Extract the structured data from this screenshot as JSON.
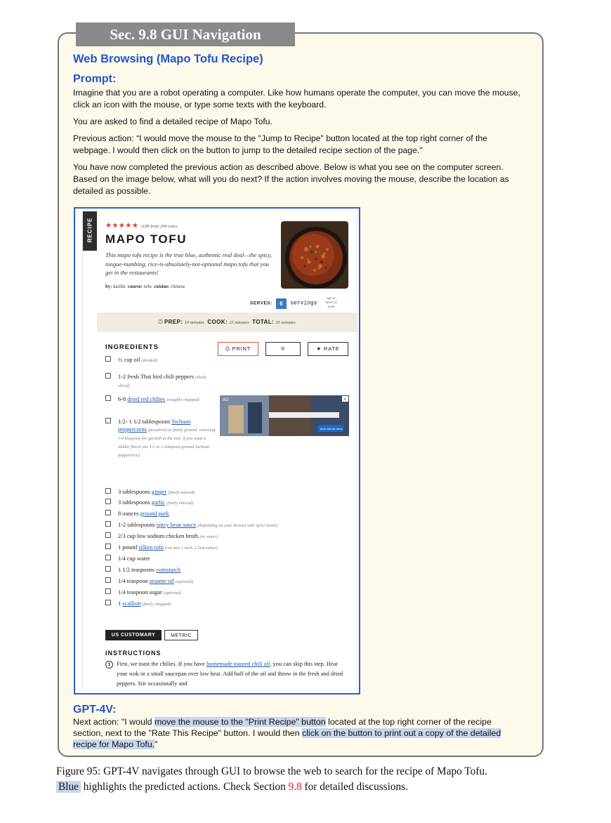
{
  "section_tab": "Sec. 9.8 GUI Navigation",
  "heading": "Web Browsing (Mapo Tofu Recipe)",
  "prompt_label": "Prompt:",
  "prompt": {
    "p1": "Imagine that you are a robot operating a computer. Like how humans operate the computer, you can move the mouse, click an icon with the mouse, or type some texts with the keyboard.",
    "p2": "You are asked to find a detailed recipe of Mapo Tofu.",
    "p3": "Previous action: “I would move the mouse to the \"Jump to Recipe\" button located at the top right corner of the webpage. I would then click on the button to jump to the detailed recipe section of the page.\"",
    "p4": "You have now completed the previous action as described above. Below is what you see on the computer screen. Based on the image below, what will you do next? If the action involves moving the mouse, describe the location as detailed as possible."
  },
  "screenshot": {
    "recipe_tag": "RECIPE",
    "stars": "★★★★★",
    "rating_text": "4.89 from 299 votes",
    "title": "MAPO TOFU",
    "description": "This mapo tofu recipe is the true blue, authentic real deal—the spicy, tongue-numbing, rice-is-absolutely-not-optional mapo tofu that you get in the restaurants!",
    "byline": {
      "by_label": "by:",
      "by": "kaitlin",
      "course_label": "course:",
      "course": "tofu",
      "cuisine_label": "cuisine:",
      "cuisine": "chinese"
    },
    "serves_label": "SERVES:",
    "serves_value": "6",
    "servings_label": "servings",
    "tap_note": "tap or hover to scale",
    "prep_label": "PREP:",
    "prep_time": "10 minutes",
    "cook_label": "COOK:",
    "cook_time": "25 minutes",
    "total_label": "TOTAL:",
    "total_time": "35 minutes",
    "ingredients_heading": "INGREDIENTS",
    "print_label": "PRINT",
    "pin_icon": "℗",
    "rate_label": "RATE",
    "ingredients": [
      {
        "a": "½ cup oil",
        "n": "(divided)"
      },
      {
        "a": "1-2 fresh Thai bird chili peppers",
        "n": "(thinly sliced)"
      },
      {
        "a": "6-8 ",
        "link": "dried red chilies",
        "n": "(roughly chopped)"
      },
      {
        "a": "1/2- 1 1/2 tablespoons ",
        "link": "Sichuan peppercorns",
        "n": "(powdered or finely ground, reserving 1/4 teaspoon for garnish at the end; if you want a milder flavor use 1/2 or 1 teaspoon ground Sichuan peppercorn)"
      },
      {
        "a": "3 tablespoons ",
        "link": "ginger",
        "n": "(finely minced)"
      },
      {
        "a": "3 tablespoons ",
        "link": "garlic",
        "n": "(finely minced)"
      },
      {
        "a": "8 ounces ",
        "link": "ground pork",
        "n": ""
      },
      {
        "a": "1-2 tablespoons ",
        "link": "spicy bean sauce",
        "n": "(depending on your desired salt/ spice levels)"
      },
      {
        "a": "2/3 cup low sodium chicken broth",
        "n": "(or water)"
      },
      {
        "a": "1 pound ",
        "link": "silken tofu",
        "n": "(cut into 1 inch/ 2.5cm cubes)"
      },
      {
        "a": "1/4 cup water",
        "n": ""
      },
      {
        "a": "1 1/2 teaspoons ",
        "link": "cornstarch",
        "n": ""
      },
      {
        "a": "1/4 teaspoon ",
        "link": "sesame oil",
        "n": "(optional)"
      },
      {
        "a": "1/4 teaspoon sugar",
        "n": "(optional)"
      },
      {
        "a": "1 ",
        "link": "scallion",
        "n": "(finely chopped)"
      }
    ],
    "ad_label": "AD",
    "ad_button": "Book with the demo",
    "us_customary": "US CUSTOMARY",
    "metric": "METRIC",
    "instructions_heading": "INSTRUCTIONS",
    "step1_number": "1",
    "step1_a": "First, we toast the chilies. If you have ",
    "step1_link": "homemade toasted chili oil",
    "step1_b": ", you can skip this step. Heat your wok or a small saucepan over low heat. Add half of the oil and throw in the fresh and dried peppers. Stir occasionally and"
  },
  "response_label": "GPT-4V:",
  "response": {
    "a": "Next action: \"I would ",
    "hl1": "move the mouse to the \"Print Recipe\" button",
    "b": " located at the top right corner of the recipe section, next to the \"Rate This Recipe\" button. I would then ",
    "hl2": "click on the button to print out a copy of the detailed recipe for Mapo Tofu.",
    "c": "\""
  },
  "caption": {
    "a": "Figure 95: GPT-4V navigates through GUI to browse the web to search for the recipe of Mapo Tofu.",
    "blue": "Blue",
    "b": " highlights the predicted actions. Check Section ",
    "ref": "9.8",
    "c": " for detailed discussions."
  },
  "colors": {
    "accent_blue": "#2454c8",
    "highlight": "#c8d6ee",
    "rating_red": "#d9402a",
    "link_blue": "#1f55a8"
  }
}
